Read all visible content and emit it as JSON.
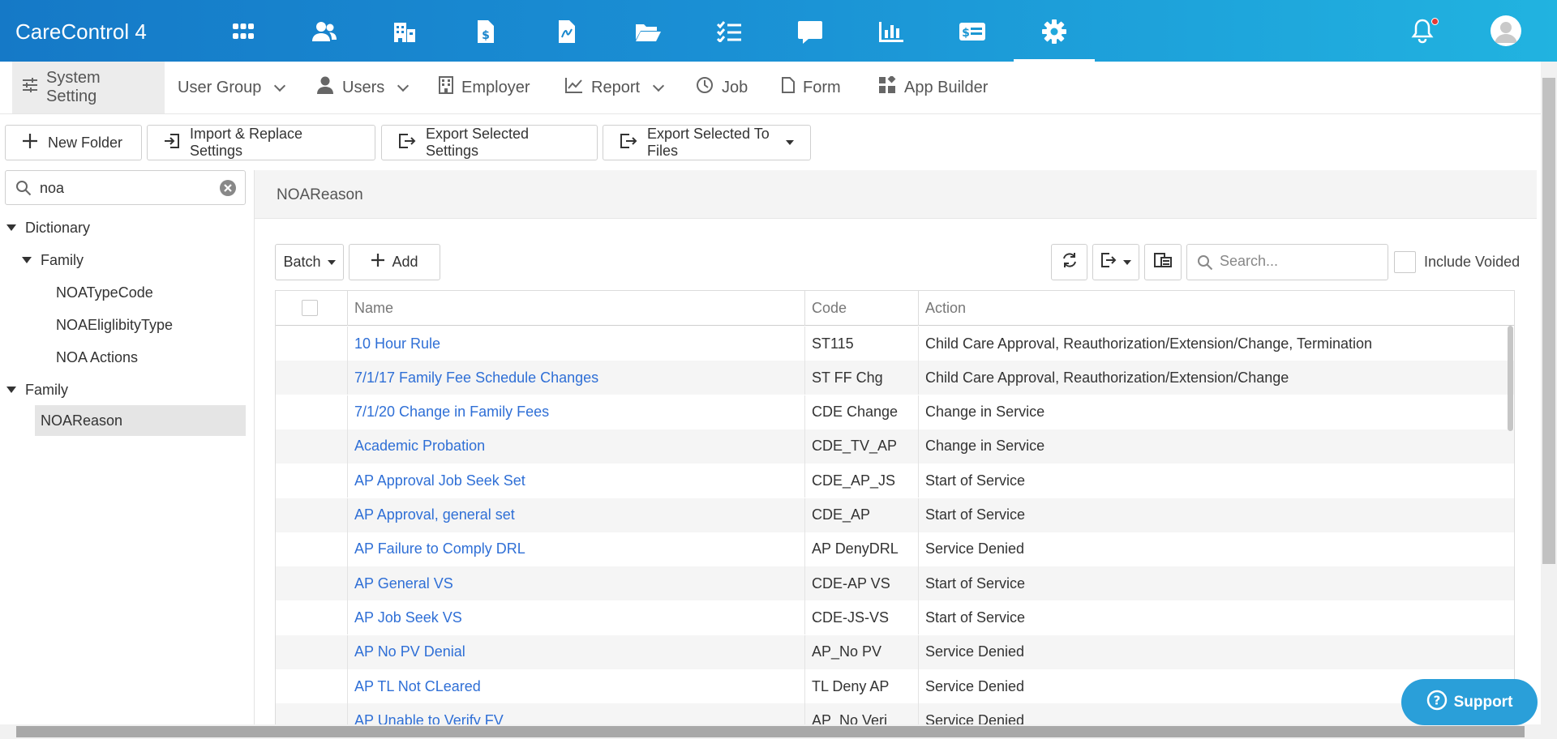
{
  "app": {
    "title": "CareControl 4"
  },
  "topnav": {
    "icons": [
      "apps-icon",
      "people-icon",
      "building-icon",
      "invoice-icon",
      "document-icon",
      "folder-icon",
      "checklist-icon",
      "chat-icon",
      "chart-icon",
      "billing-icon",
      "settings-icon"
    ],
    "active": "settings-icon"
  },
  "submenu": {
    "items": [
      {
        "label": "System Setting",
        "icon": "sliders-icon",
        "dropdown": false,
        "active": true
      },
      {
        "label": "User Group",
        "icon": "",
        "dropdown": true,
        "active": false
      },
      {
        "label": "Users",
        "icon": "user-icon",
        "dropdown": true,
        "active": false
      },
      {
        "label": "Employer",
        "icon": "building-icon",
        "dropdown": false,
        "active": false
      },
      {
        "label": "Report",
        "icon": "line-chart-icon",
        "dropdown": true,
        "active": false
      },
      {
        "label": "Job",
        "icon": "clock-icon",
        "dropdown": false,
        "active": false
      },
      {
        "label": "Form",
        "icon": "file-icon",
        "dropdown": false,
        "active": false
      },
      {
        "label": "App Builder",
        "icon": "widgets-icon",
        "dropdown": false,
        "active": false
      }
    ]
  },
  "toolbar": {
    "new_folder": "New Folder",
    "import_replace": "Import & Replace Settings",
    "export_selected": "Export Selected Settings",
    "export_files": "Export Selected To Files"
  },
  "tree": {
    "search_value": "noa",
    "nodes": [
      {
        "label": "Dictionary",
        "level": 0,
        "expanded": true
      },
      {
        "label": "Family",
        "level": 1,
        "expanded": true
      },
      {
        "label": "NOATypeCode",
        "level": 2
      },
      {
        "label": "NOAEliglibityType",
        "level": 2
      },
      {
        "label": "NOA Actions",
        "level": 2
      },
      {
        "label": "Family",
        "level": 0,
        "expanded": true
      },
      {
        "label": "NOAReason",
        "level": 1,
        "selected": true
      }
    ]
  },
  "panel": {
    "title": "NOAReason",
    "batch_label": "Batch",
    "add_label": "Add",
    "search_placeholder": "Search...",
    "include_voided": "Include Voided"
  },
  "grid": {
    "columns": [
      "Name",
      "Code",
      "Action"
    ],
    "rows": [
      {
        "name": "10 Hour Rule",
        "code": "ST115",
        "action": "Child Care Approval, Reauthorization/Extension/Change, Termination"
      },
      {
        "name": "7/1/17 Family Fee Schedule Changes",
        "code": "ST FF Chg",
        "action": "Child Care Approval, Reauthorization/Extension/Change"
      },
      {
        "name": "7/1/20 Change in Family Fees",
        "code": "CDE Change",
        "action": "Change in Service"
      },
      {
        "name": "Academic Probation",
        "code": "CDE_TV_AP",
        "action": "Change in Service"
      },
      {
        "name": "AP Approval Job Seek Set",
        "code": "CDE_AP_JS",
        "action": "Start of Service"
      },
      {
        "name": "AP Approval, general set",
        "code": "CDE_AP",
        "action": "Start of Service"
      },
      {
        "name": "AP Failure to Comply DRL",
        "code": "AP DenyDRL",
        "action": "Service Denied"
      },
      {
        "name": "AP General VS",
        "code": "CDE-AP VS",
        "action": "Start of Service"
      },
      {
        "name": "AP Job Seek VS",
        "code": "CDE-JS-VS",
        "action": "Start of Service"
      },
      {
        "name": "AP No PV Denial",
        "code": "AP_No PV",
        "action": "Service Denied"
      },
      {
        "name": "AP TL Not CLeared",
        "code": "TL Deny AP",
        "action": "Service Denied"
      },
      {
        "name": "AP Unable to Verify FV",
        "code": "AP_No Veri",
        "action": "Service Denied"
      }
    ]
  },
  "support": {
    "label": "Support"
  },
  "colors": {
    "accent": "#1a8fd4",
    "link": "#2f6fd6",
    "support": "#2a9fd9"
  }
}
